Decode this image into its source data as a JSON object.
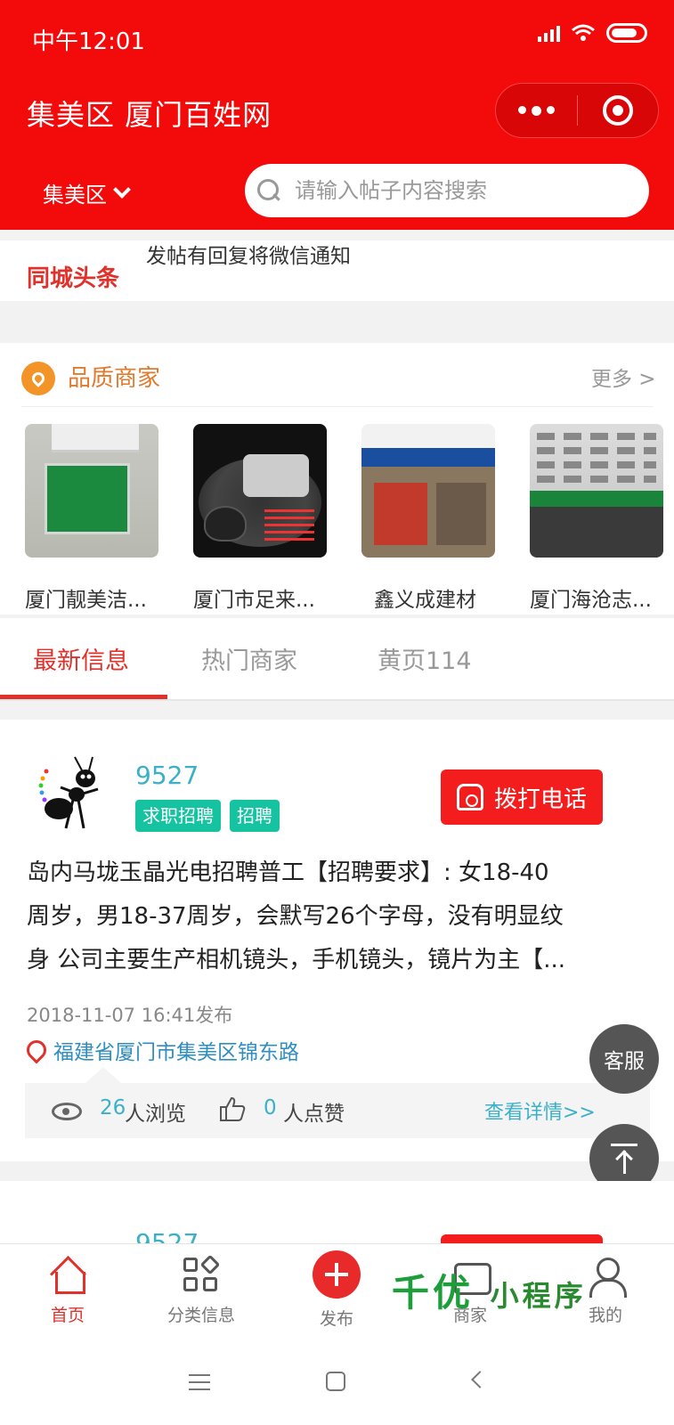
{
  "status_bar": {
    "time": "中午12:01"
  },
  "header": {
    "title": "集美区 厦门百姓网",
    "region": "集美区",
    "search_placeholder": "请输入帖子内容搜索"
  },
  "headline": {
    "label": "同城头条",
    "text": "发帖有回复将微信通知"
  },
  "quality": {
    "title": "品质商家",
    "more": "更多 >",
    "shops": [
      {
        "name": "厦门靓美洁..."
      },
      {
        "name": "厦门市足来..."
      },
      {
        "name": "鑫义成建材"
      },
      {
        "name": "厦门海沧志..."
      }
    ]
  },
  "tabs": [
    {
      "label": "最新信息",
      "active": true
    },
    {
      "label": "热门商家",
      "active": false
    },
    {
      "label": "黄页114",
      "active": false
    }
  ],
  "post": {
    "user": "9527",
    "tags": [
      "求职招聘",
      "招聘"
    ],
    "call_label": "拨打电话",
    "lines": [
      "岛内马垅玉晶光电招聘普工【招聘要求】: 女18-40",
      "周岁，男18-37周岁，会默写26个字母，没有明显纹",
      "身 公司主要生产相机镜头，手机镜头，镜片为主【..."
    ],
    "date": "2018-11-07 16:41发布",
    "location": "福建省厦门市集美区锦东路",
    "views": "26",
    "views_label": "人浏览",
    "likes": "0",
    "likes_label": "人点赞",
    "detail_label": "查看详情>>"
  },
  "post2": {
    "user": "9527"
  },
  "floating": {
    "service": "客服"
  },
  "bottom_nav": [
    {
      "label": "首页",
      "icon": "home-icon",
      "active": true
    },
    {
      "label": "分类信息",
      "icon": "category-icon",
      "active": false
    },
    {
      "label": "发布",
      "icon": "plus-icon",
      "active": false
    },
    {
      "label": "商家",
      "icon": "shop-icon",
      "active": false
    },
    {
      "label": "我的",
      "icon": "user-icon",
      "active": false
    }
  ],
  "watermark": {
    "main": "千优",
    "sub": "小程序"
  },
  "colors": {
    "header_red": "#f30a0a",
    "accent_red": "#e0312b",
    "tag_green": "#16c3a0",
    "link_blue": "#3bb0c9"
  }
}
